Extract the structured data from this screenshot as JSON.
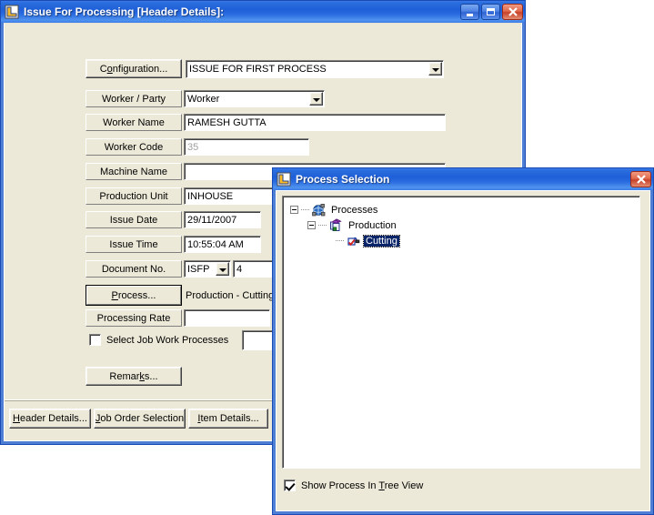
{
  "desktop": {
    "background": "#ffffff"
  },
  "main_window": {
    "title": "Issue For Processing [Header Details]:",
    "icon": "app-logo-icon",
    "caption_buttons": [
      {
        "name": "minimize",
        "glyph": "minimize-icon"
      },
      {
        "name": "maximize",
        "glyph": "maximize-icon"
      },
      {
        "name": "close",
        "glyph": "close-icon",
        "color": "#c8412a"
      }
    ],
    "titlebar_color": "#1f5fd8",
    "fields": {
      "configuration": {
        "label_pre": "C",
        "label_accel": "o",
        "label_post": "nfiguration...",
        "value": "ISSUE FOR FIRST PROCESS"
      },
      "worker_party": {
        "label": "Worker / Party",
        "value": "Worker"
      },
      "worker_name": {
        "label": "Worker Name",
        "value": "RAMESH GUTTA"
      },
      "worker_code": {
        "label": "Worker Code",
        "value": "35"
      },
      "machine_name": {
        "label": "Machine Name",
        "value": ""
      },
      "production_unit": {
        "label": "Production Unit",
        "value": "INHOUSE"
      },
      "issue_date": {
        "label": "Issue Date",
        "value": "29/11/2007"
      },
      "issue_time": {
        "label": "Issue Time",
        "value": "10:55:04 AM"
      },
      "document_no": {
        "label": "Document No.",
        "prefix": "ISFP",
        "number": "4"
      },
      "process": {
        "label_pre": "",
        "label_accel": "P",
        "label_post": "rocess...",
        "value": "Production - Cutting"
      },
      "processing_rate": {
        "label": "Processing Rate",
        "value": ""
      },
      "select_job_work": {
        "label": "Select Job Work Processes",
        "checked": false,
        "value": ""
      },
      "remarks": {
        "label_pre": "Remar",
        "label_accel": "k",
        "label_post": "s..."
      }
    },
    "tabs": [
      {
        "pre": "",
        "accel": "H",
        "post": "eader Details...",
        "name": "header-details"
      },
      {
        "pre": "",
        "accel": "J",
        "post": "ob Order Selection",
        "name": "job-order-selection"
      },
      {
        "pre": "",
        "accel": "I",
        "post": "tem Details...",
        "name": "item-details"
      }
    ]
  },
  "dialog": {
    "title": "Process Selection",
    "icon": "app-logo-icon",
    "close_button": "close-icon",
    "tree": [
      {
        "level": 1,
        "label": "Processes",
        "icon": "globe-network-icon",
        "expanded": true,
        "selected": false
      },
      {
        "level": 2,
        "label": "Production",
        "icon": "process-stack-icon",
        "expanded": true,
        "selected": false
      },
      {
        "level": 3,
        "label": "Cutting",
        "icon": "process-leaf-icon",
        "expanded": null,
        "selected": true
      }
    ],
    "footer_checkbox": {
      "pre": "Show Process In ",
      "accel": "T",
      "post": "ree View",
      "checked": true
    },
    "selection_color": "#0a246a"
  }
}
